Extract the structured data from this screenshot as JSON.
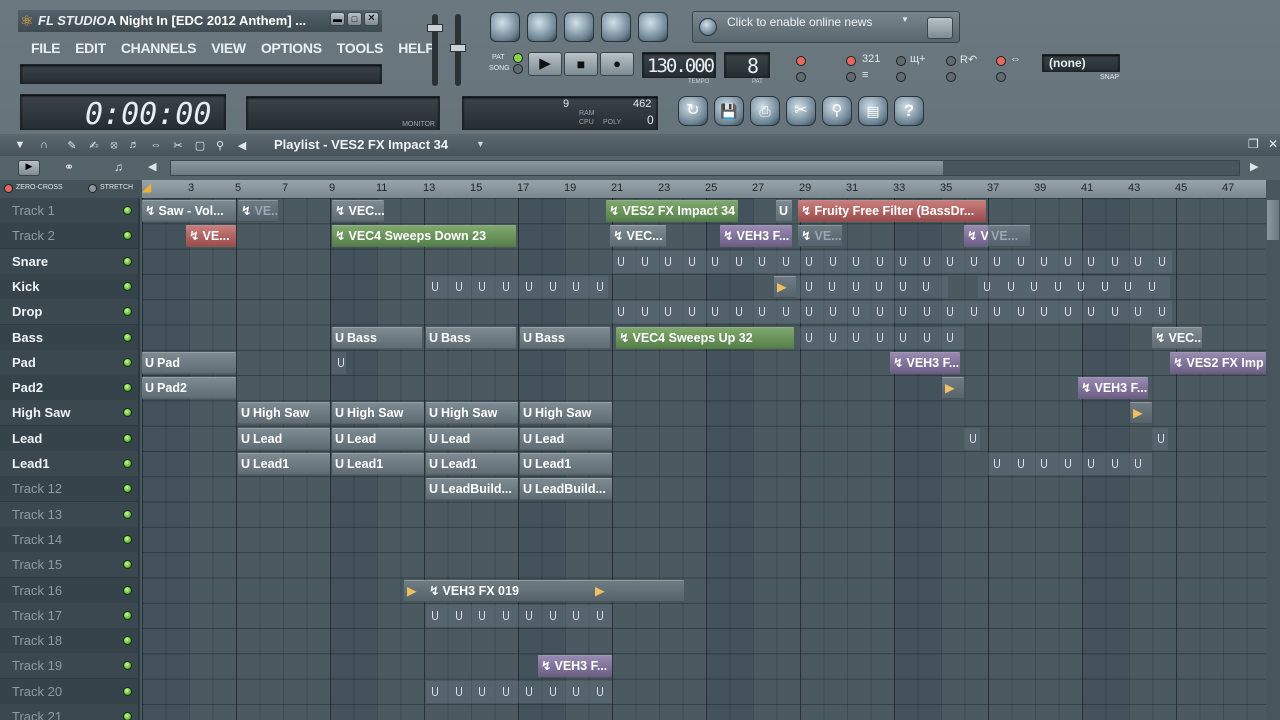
{
  "app": {
    "logo": "FL STUDIO",
    "song_title": "A Night In [EDC 2012 Anthem] ..."
  },
  "menu": [
    "FILE",
    "EDIT",
    "CHANNELS",
    "VIEW",
    "OPTIONS",
    "TOOLS",
    "HELP"
  ],
  "time_display": "0:00:00",
  "mini_display": {
    "label_left": "MONITOR",
    "cpu_label": "CPU",
    "ram_label": "RAM",
    "poly_label": "POLY",
    "value_a": "9",
    "value_b": "462",
    "value_c": "0"
  },
  "transport": {
    "pat_label": "PAT",
    "song_label": "SONG",
    "tempo": "130.000",
    "tempo_label": "TEMPO",
    "pattern": "8",
    "pattern_label": "PAT"
  },
  "news": {
    "text": "Click to enable online news"
  },
  "snap": {
    "value": "(none)",
    "label": "SNAP"
  },
  "playlist": {
    "title": "Playlist - VES2 FX Impact 34",
    "zero_cross": "ZERO-CROSS",
    "stretch": "STRETCH",
    "ruler": [
      "3",
      "5",
      "7",
      "9",
      "11",
      "13",
      "15",
      "17",
      "19",
      "21",
      "23",
      "25",
      "27",
      "29",
      "31",
      "33",
      "35",
      "37",
      "39",
      "41",
      "43",
      "45",
      "47"
    ],
    "tracks": [
      "Track 1",
      "Track 2",
      "Snare",
      "Kick",
      "Drop",
      "Bass",
      "Pad",
      "Pad2",
      "High Saw",
      "Lead",
      "Lead1",
      "Track 12",
      "Track 13",
      "Track 14",
      "Track 15",
      "Track 16",
      "Track 17",
      "Track 18",
      "Track 19",
      "Track 20",
      "Track 21"
    ],
    "clip_labels": {
      "saw_vol": "Saw - Vol...",
      "ve_a": "VE...",
      "vec_a": "VEC...",
      "ves2_impact": "VES2 FX Impact 34",
      "u": "U",
      "fruity": "Fruity Free Filter (BassDr...",
      "ve_b": "VE...",
      "vec4_down": "VEC4 Sweeps Down 23",
      "vec_b": "VEC...",
      "veh3_a": "VEH3 F...",
      "ve_c": "VE...",
      "v": "V",
      "ve_d": "VE...",
      "bass1": "Bass",
      "bass2": "Bass",
      "bass3": "Bass",
      "vec4_up": "VEC4 Sweeps Up 32",
      "vec_c": "VEC...",
      "pad": "Pad",
      "veh3_b": "VEH3 F...",
      "ves2_imp": "VES2 FX Imp",
      "pad2": "Pad2",
      "veh3_c": "VEH3 F...",
      "hs1": "High Saw",
      "hs2": "High Saw",
      "hs3": "High Saw",
      "hs4": "High Saw",
      "l1": "Lead",
      "l2": "Lead",
      "l3": "Lead",
      "l4": "Lead",
      "ld1": "Lead1",
      "ld2": "Lead1",
      "ld3": "Lead1",
      "ld4": "Lead1",
      "lb1": "LeadBuild...",
      "lb2": "LeadBuild...",
      "veh3_fx019": "VEH3 FX 019",
      "veh3_d": "VEH3 F..."
    }
  }
}
